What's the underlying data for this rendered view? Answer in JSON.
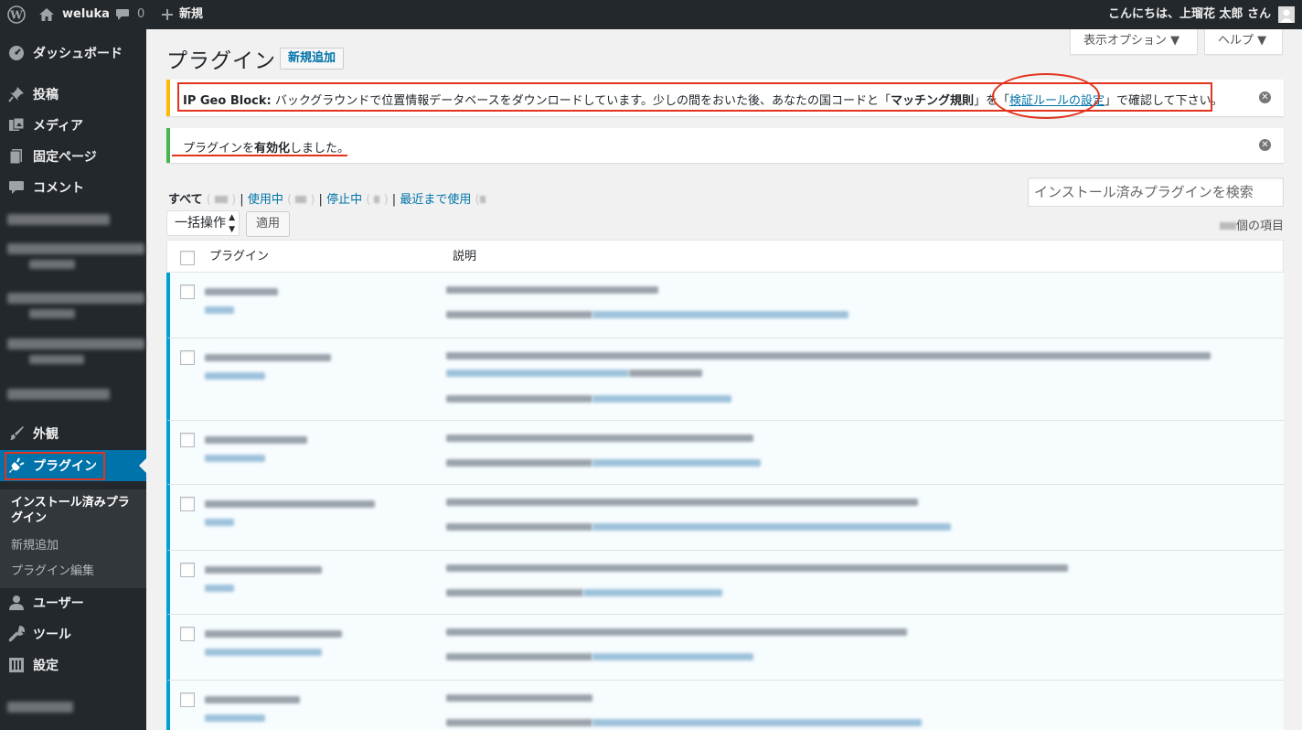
{
  "adminbar": {
    "site_name": "weluka",
    "comments_count": "0",
    "new_label": "新規",
    "greeting": "こんにちは、上瑠花 太郎 さん"
  },
  "sidebar": {
    "dashboard": "ダッシュボード",
    "posts": "投稿",
    "media": "メディア",
    "pages": "固定ページ",
    "comments": "コメント",
    "appearance": "外観",
    "plugins": "プラグイン",
    "submenu": [
      "インストール済みプラグイン",
      "新規追加",
      "プラグイン編集"
    ],
    "users": "ユーザー",
    "tools": "ツール",
    "settings": "設定"
  },
  "header": {
    "title": "プラグイン",
    "add_new": "新規追加",
    "screen_options": "表示オプション ▼",
    "help": "ヘルプ ▼"
  },
  "notices": {
    "warn_strong": "IP Geo Block:",
    "warn_text": " バックグラウンドで位置情報データベースをダウンロードしています。少しの間をおいた後、あなたの国コードと「",
    "warn_strong2": "マッチング規則",
    "warn_text2": "」を「",
    "warn_link": "検証ルールの設定",
    "warn_text3": "」で確認して下さい。",
    "ok_text1": "プラグインを",
    "ok_strong": "有効化",
    "ok_text2": "しました。"
  },
  "filters": {
    "all": "すべて",
    "active": "使用中",
    "inactive": "停止中",
    "recent": "最近まで使用"
  },
  "search_placeholder": "インストール済みプラグインを検索",
  "bulk_action": "一括操作",
  "apply": "適用",
  "items_suffix": "個の項目",
  "table": {
    "col_plugin": "プラグイン",
    "col_desc": "説明"
  }
}
